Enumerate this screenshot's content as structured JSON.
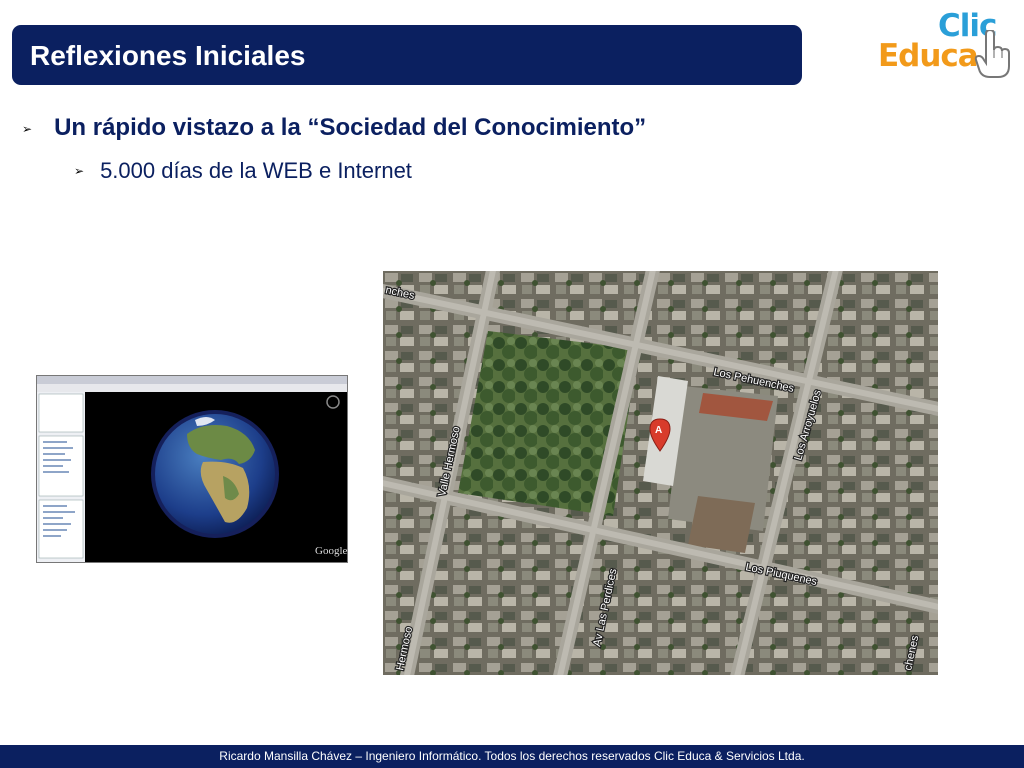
{
  "slide": {
    "title": "Reflexiones Iniciales",
    "bullet1": "Un rápido vistazo a la “Sociedad del Conocimiento”",
    "bullet2": "5.000 días de la WEB e Internet"
  },
  "logo": {
    "clic": "Clic",
    "educa": "Educa"
  },
  "earth_screenshot": {
    "watermark": "Google"
  },
  "map": {
    "marker": "A",
    "streets": [
      "Los Pehuenches",
      "Los Arroyuelos",
      "Valle Hermoso",
      "Los Piuquenes",
      "Av Las Perdices",
      "Hermoso",
      "nches",
      "chenes"
    ]
  },
  "footer": {
    "text": "Ricardo Mansilla Chávez – Ingeniero Informático.  Todos los derechos reservados Clic Educa  &  Servicios Ltda."
  },
  "colors": {
    "title_bar": "#0b2060",
    "clic_blue": "#2a9fd8",
    "educa_orange": "#f29a1a",
    "marker_red": "#d83b2b"
  }
}
